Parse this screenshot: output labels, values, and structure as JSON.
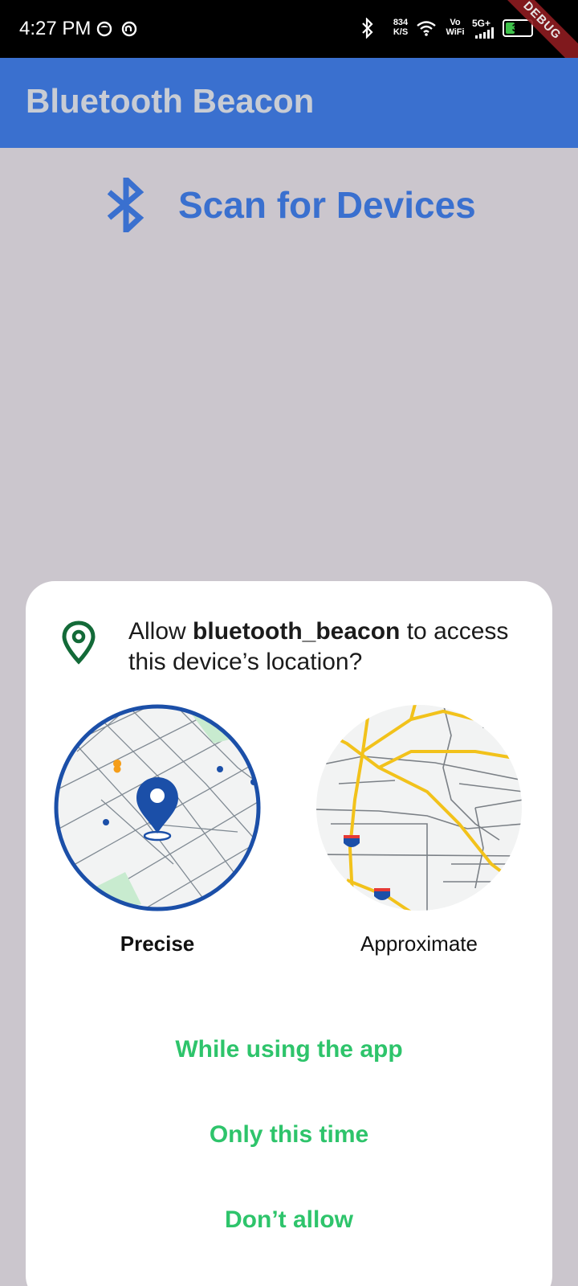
{
  "status_bar": {
    "time": "4:27 PM",
    "net_speed_value": "834",
    "net_speed_unit": "K/S",
    "vo": "Vo",
    "wifi": "WiFi",
    "network": "5G+",
    "battery": "37",
    "battery_level": 0.37,
    "debug_label": "DEBUG"
  },
  "app_bar": {
    "title": "Bluetooth Beacon"
  },
  "main": {
    "scan_label": "Scan for Devices"
  },
  "dialog": {
    "title_prefix": "Allow ",
    "app_name": "bluetooth_beacon",
    "title_suffix": " to access this device’s location?",
    "precise_label": "Precise",
    "approximate_label": "Approximate",
    "while_using": "While using the app",
    "only_this_time": "Only this time",
    "dont_allow": "Don’t allow"
  },
  "colors": {
    "app_bar": "#3a70cf",
    "background": "#cbc6cd",
    "accent_green": "#2ec46b",
    "map_blue": "#1b4fa8",
    "road_yellow": "#f2c21b"
  }
}
